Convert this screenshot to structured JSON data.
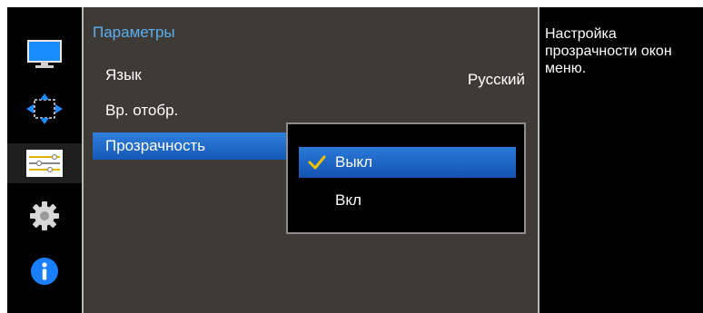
{
  "sidebar": {
    "items": [
      {
        "icon": "monitor-icon",
        "active": false
      },
      {
        "icon": "resize-arrows-icon",
        "active": false
      },
      {
        "icon": "sliders-icon",
        "active": true
      },
      {
        "icon": "gear-icon",
        "active": false
      },
      {
        "icon": "info-icon",
        "active": false
      }
    ]
  },
  "menu": {
    "title": "Параметры",
    "items": [
      {
        "label": "Язык",
        "value": "Русский",
        "selected": false
      },
      {
        "label": "Вр. отобр.",
        "selected": false
      },
      {
        "label": "Прозрачность",
        "selected": true
      }
    ]
  },
  "dropdown": {
    "options": [
      {
        "label": "Выкл",
        "checked": true
      },
      {
        "label": "Вкл",
        "checked": false
      }
    ]
  },
  "help": {
    "text": "Настройка прозрачности окон меню."
  },
  "colors": {
    "accent": "#1e6fd8",
    "title": "#5aaef0",
    "panel_bg": "#3e3a36",
    "check": "#f2c200"
  }
}
